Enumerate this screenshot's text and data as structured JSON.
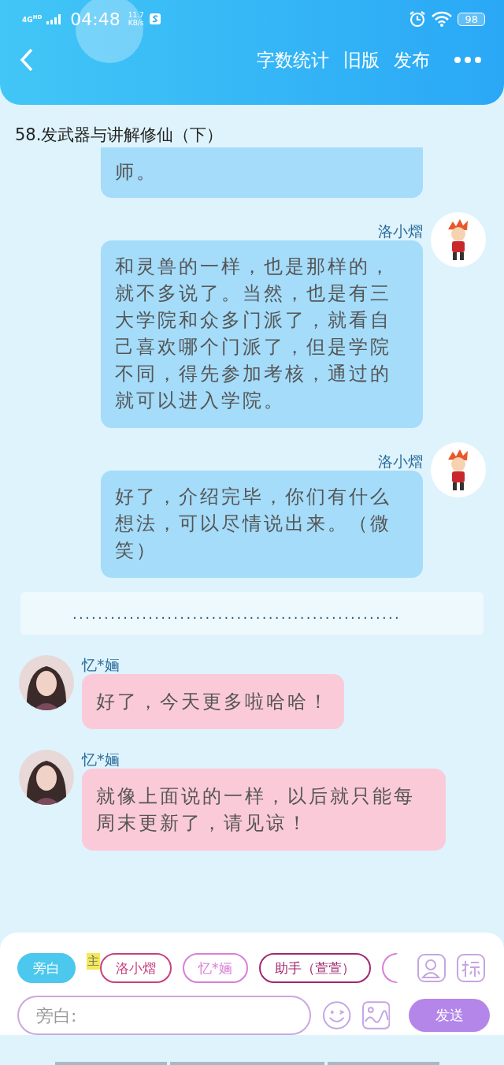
{
  "status_bar": {
    "network": "4G",
    "network_badge": "HD",
    "time": "04:48",
    "speed": "11.7",
    "speed_unit": "KB/s",
    "battery": "98"
  },
  "header": {
    "actions": [
      "字数统计",
      "旧版",
      "发布"
    ]
  },
  "chapter_title": "58.发武器与讲解修仙（下）",
  "messages": [
    {
      "kind": "right",
      "text": "师。"
    },
    {
      "kind": "right",
      "name": "洛小熠",
      "text": "和灵兽的一样，也是那样的，就不多说了。当然，也是有三大学院和众多门派了，就看自己喜欢哪个门派了，但是学院不同，得先参加考核，通过的就可以进入学院。"
    },
    {
      "kind": "right",
      "name": "洛小熠",
      "text": "好了，介绍完毕，你们有什么想法，可以尽情说出来。（微笑）"
    },
    {
      "kind": "narration",
      "text": "...................................................."
    },
    {
      "kind": "left",
      "name": "忆*婳",
      "text": "好了，今天更多啦哈哈！"
    },
    {
      "kind": "left",
      "name": "忆*婳",
      "text": "就像上面说的一样，以后就只能每周末更新了，请见谅！"
    }
  ],
  "roles": [
    {
      "label": "旁白",
      "selected": true,
      "color": "#4cc8ee"
    },
    {
      "label": "洛小熠",
      "selected": false,
      "color": "#c8407e",
      "badge": "主"
    },
    {
      "label": "忆*婳",
      "selected": false,
      "color": "#d87ed8"
    },
    {
      "label": "助手（萱萱）",
      "selected": false,
      "color": "#a02870"
    },
    {
      "selected": false,
      "color": "#d87ed8"
    }
  ],
  "composer": {
    "placeholder": "旁白:",
    "send": "发送"
  }
}
